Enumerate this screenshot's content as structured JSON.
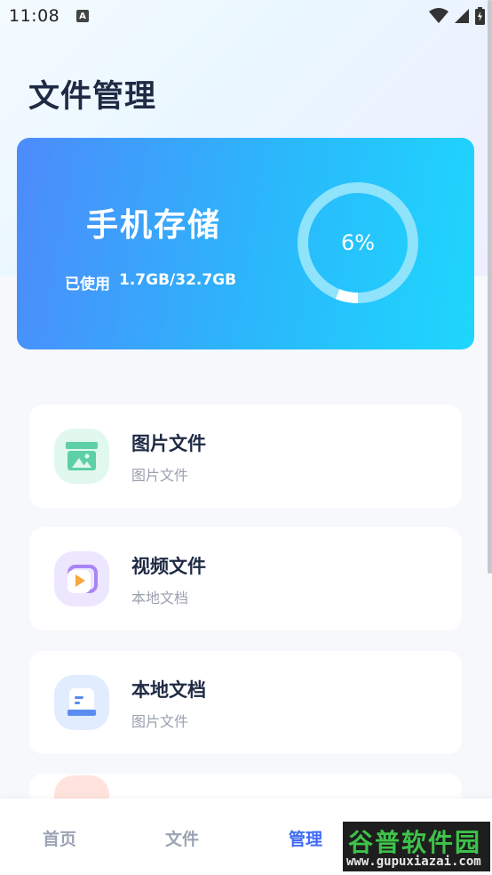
{
  "status_bar": {
    "time": "11:08",
    "notification_badge": "A",
    "icons": [
      "wifi-icon",
      "signal-icon",
      "battery-charging-icon"
    ]
  },
  "page": {
    "title": "文件管理"
  },
  "storage": {
    "title": "手机存储",
    "used_label": "已使用",
    "used_value": "1.7GB/32.7GB",
    "percent_text": "6%",
    "percent": 6,
    "ring_track_color": "#8fe3fb",
    "ring_fill_color": "#ffffff"
  },
  "items": [
    {
      "title": "图片文件",
      "subtitle": "图片文件",
      "icon": "image-file-icon",
      "icon_bg": "#e1f8ee",
      "icon_color": "#5ed0a6"
    },
    {
      "title": "视频文件",
      "subtitle": "本地文档",
      "icon": "video-file-icon",
      "icon_bg": "#ede6ff",
      "icon_color": "#a884f7"
    },
    {
      "title": "本地文档",
      "subtitle": "图片文件",
      "icon": "document-icon",
      "icon_bg": "#e1ecff",
      "icon_color": "#5b8cf0"
    }
  ],
  "tabs": [
    {
      "label": "首页",
      "active": false
    },
    {
      "label": "文件",
      "active": false
    },
    {
      "label": "管理",
      "active": true
    }
  ],
  "watermark": {
    "main": "谷普软件园",
    "url": "www.gupuxiazai.com"
  },
  "colors": {
    "accent": "#3f6bf4",
    "title": "#1f2a44",
    "subtitle": "#9aa1ae"
  }
}
